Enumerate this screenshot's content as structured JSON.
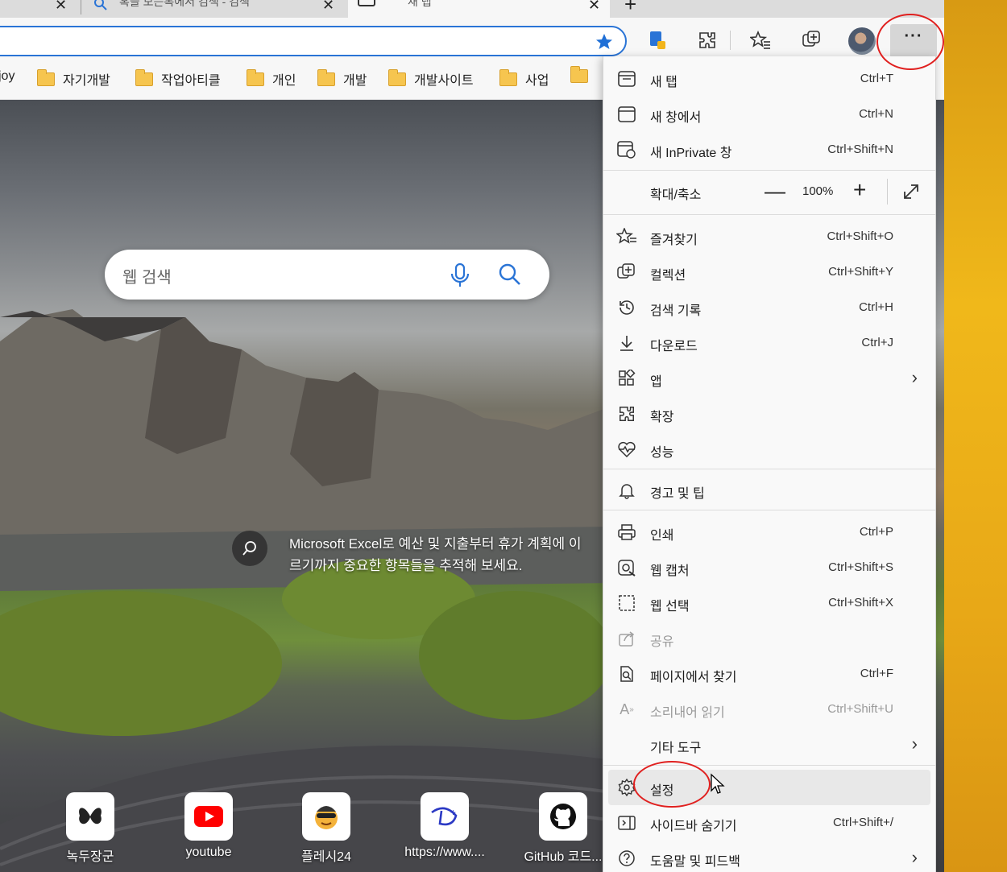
{
  "tabs": [
    {
      "title": "",
      "close": "✕"
    },
    {
      "title": "혹을 모든복에서 검색 - 검색",
      "close": "✕"
    },
    {
      "title": "새 탭",
      "close": "✕"
    }
  ],
  "new_tab_plus": "+",
  "favorites": [
    {
      "label": "joy"
    },
    {
      "label": "자기개발"
    },
    {
      "label": "작업아티클"
    },
    {
      "label": "개인"
    },
    {
      "label": "개발"
    },
    {
      "label": "개발사이트"
    },
    {
      "label": "사업"
    },
    {
      "label": ""
    }
  ],
  "ntp": {
    "search_placeholder": "웹 검색",
    "fact_text": "Microsoft Excel로 예산 및 지출부터 휴가 계획에 이르기까지 중요한 항목들을 추적해 보세요.",
    "quick_links": [
      {
        "label": "녹두장군",
        "icon": "butterfly-icon"
      },
      {
        "label": "youtube",
        "icon": "youtube-icon"
      },
      {
        "label": "플레시24",
        "icon": "face-icon"
      },
      {
        "label": "https://www....",
        "icon": "disney-plus-icon"
      },
      {
        "label": "GitHub 코드...",
        "icon": "github-icon"
      }
    ]
  },
  "menu": {
    "items": [
      {
        "label": "새 탭",
        "shortcut": "Ctrl+T",
        "icon": "new-tab-icon"
      },
      {
        "label": "새 창에서",
        "shortcut": "Ctrl+N",
        "icon": "new-window-icon"
      },
      {
        "label": "새 InPrivate 창",
        "shortcut": "Ctrl+Shift+N",
        "icon": "inprivate-icon"
      },
      {
        "label": "확대/축소",
        "icon": "zoom"
      },
      {
        "label": "즐겨찾기",
        "shortcut": "Ctrl+Shift+O",
        "icon": "favorites-icon"
      },
      {
        "label": "컬렉션",
        "shortcut": "Ctrl+Shift+Y",
        "icon": "collections-icon"
      },
      {
        "label": "검색 기록",
        "shortcut": "Ctrl+H",
        "icon": "history-icon"
      },
      {
        "label": "다운로드",
        "shortcut": "Ctrl+J",
        "icon": "download-icon"
      },
      {
        "label": "앱",
        "icon": "apps-icon"
      },
      {
        "label": "확장",
        "icon": "extensions-icon"
      },
      {
        "label": "성능",
        "icon": "performance-icon"
      },
      {
        "label": "경고 및 팁",
        "icon": "bell-icon"
      },
      {
        "label": "인쇄",
        "shortcut": "Ctrl+P",
        "icon": "print-icon"
      },
      {
        "label": "웹 캡처",
        "shortcut": "Ctrl+Shift+S",
        "icon": "web-capture-icon"
      },
      {
        "label": "웹 선택",
        "shortcut": "Ctrl+Shift+X",
        "icon": "web-select-icon"
      },
      {
        "label": "공유",
        "icon": "share-icon"
      },
      {
        "label": "페이지에서 찾기",
        "shortcut": "Ctrl+F",
        "icon": "find-icon"
      },
      {
        "label": "소리내어 읽기",
        "shortcut": "Ctrl+Shift+U",
        "icon": "read-aloud-icon"
      },
      {
        "label": "기타 도구",
        "icon": ""
      },
      {
        "label": "설정",
        "icon": "gear-icon"
      },
      {
        "label": "사이드바 숨기기",
        "shortcut": "Ctrl+Shift+/",
        "icon": "sidebar-icon"
      },
      {
        "label": "도움말 및 피드백",
        "icon": "help-icon"
      }
    ],
    "zoom_minus": "—",
    "zoom_value": "100%",
    "zoom_plus": "+",
    "more_button": "···",
    "submenu_arrow": "›"
  },
  "colors": {
    "accent": "#2a74d6",
    "annotation": "#e0201f",
    "menu_bg": "#f9f9f9"
  }
}
